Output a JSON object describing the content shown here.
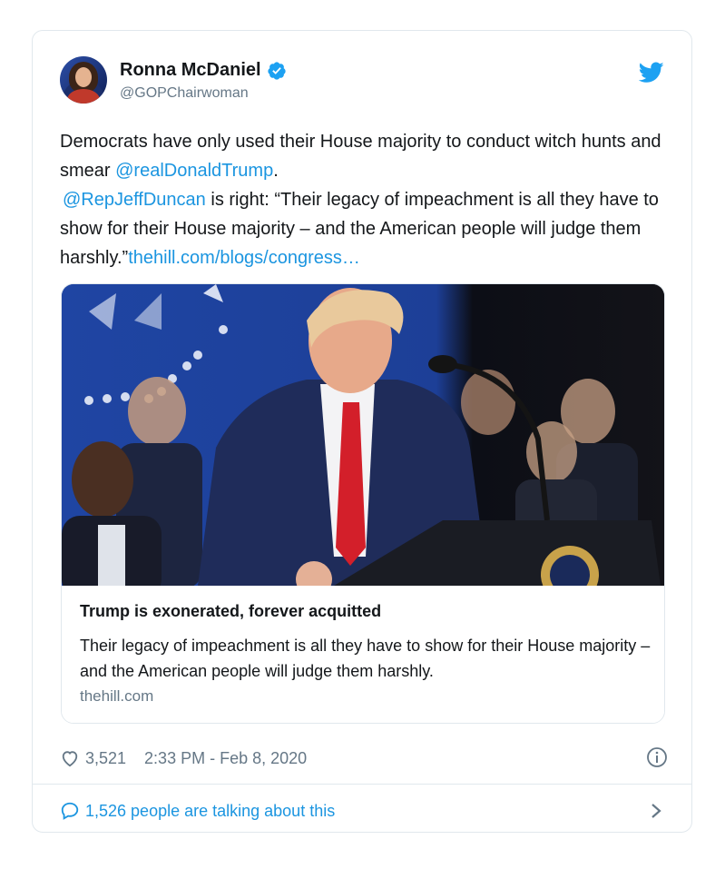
{
  "tweet": {
    "author_name": "Ronna McDaniel",
    "handle": "@GOPChairwoman",
    "text_part1": "Democrats have only used their House majority to conduct witch hunts and smear ",
    "mention1": "@realDonaldTrump",
    "text_part2": ".",
    "mention2": "@RepJeffDuncan",
    "text_part3": " is right: “Their legacy of impeachment is all they have to show for their House majority – and the American people will judge them harshly.”",
    "link": "thehill.com/blogs/congress…",
    "likes": "3,521",
    "timestamp": "2:33 PM - Feb 8, 2020",
    "talking": "1,526 people are talking about this"
  },
  "card": {
    "title": "Trump is exonerated, forever acquitted",
    "description": "Their legacy of impeachment is all they have to show for their House majority – and the American people will judge them harshly.",
    "domain": "thehill.com"
  },
  "icons": {
    "verified": "verified-badge-icon",
    "bird": "twitter-bird-icon",
    "heart": "heart-icon",
    "info": "info-icon",
    "bubble": "speech-bubble-icon",
    "chevron": "chevron-right-icon"
  },
  "colors": {
    "link": "#1b95e0",
    "secondary_text": "#657786",
    "border": "#e1e8ed"
  }
}
